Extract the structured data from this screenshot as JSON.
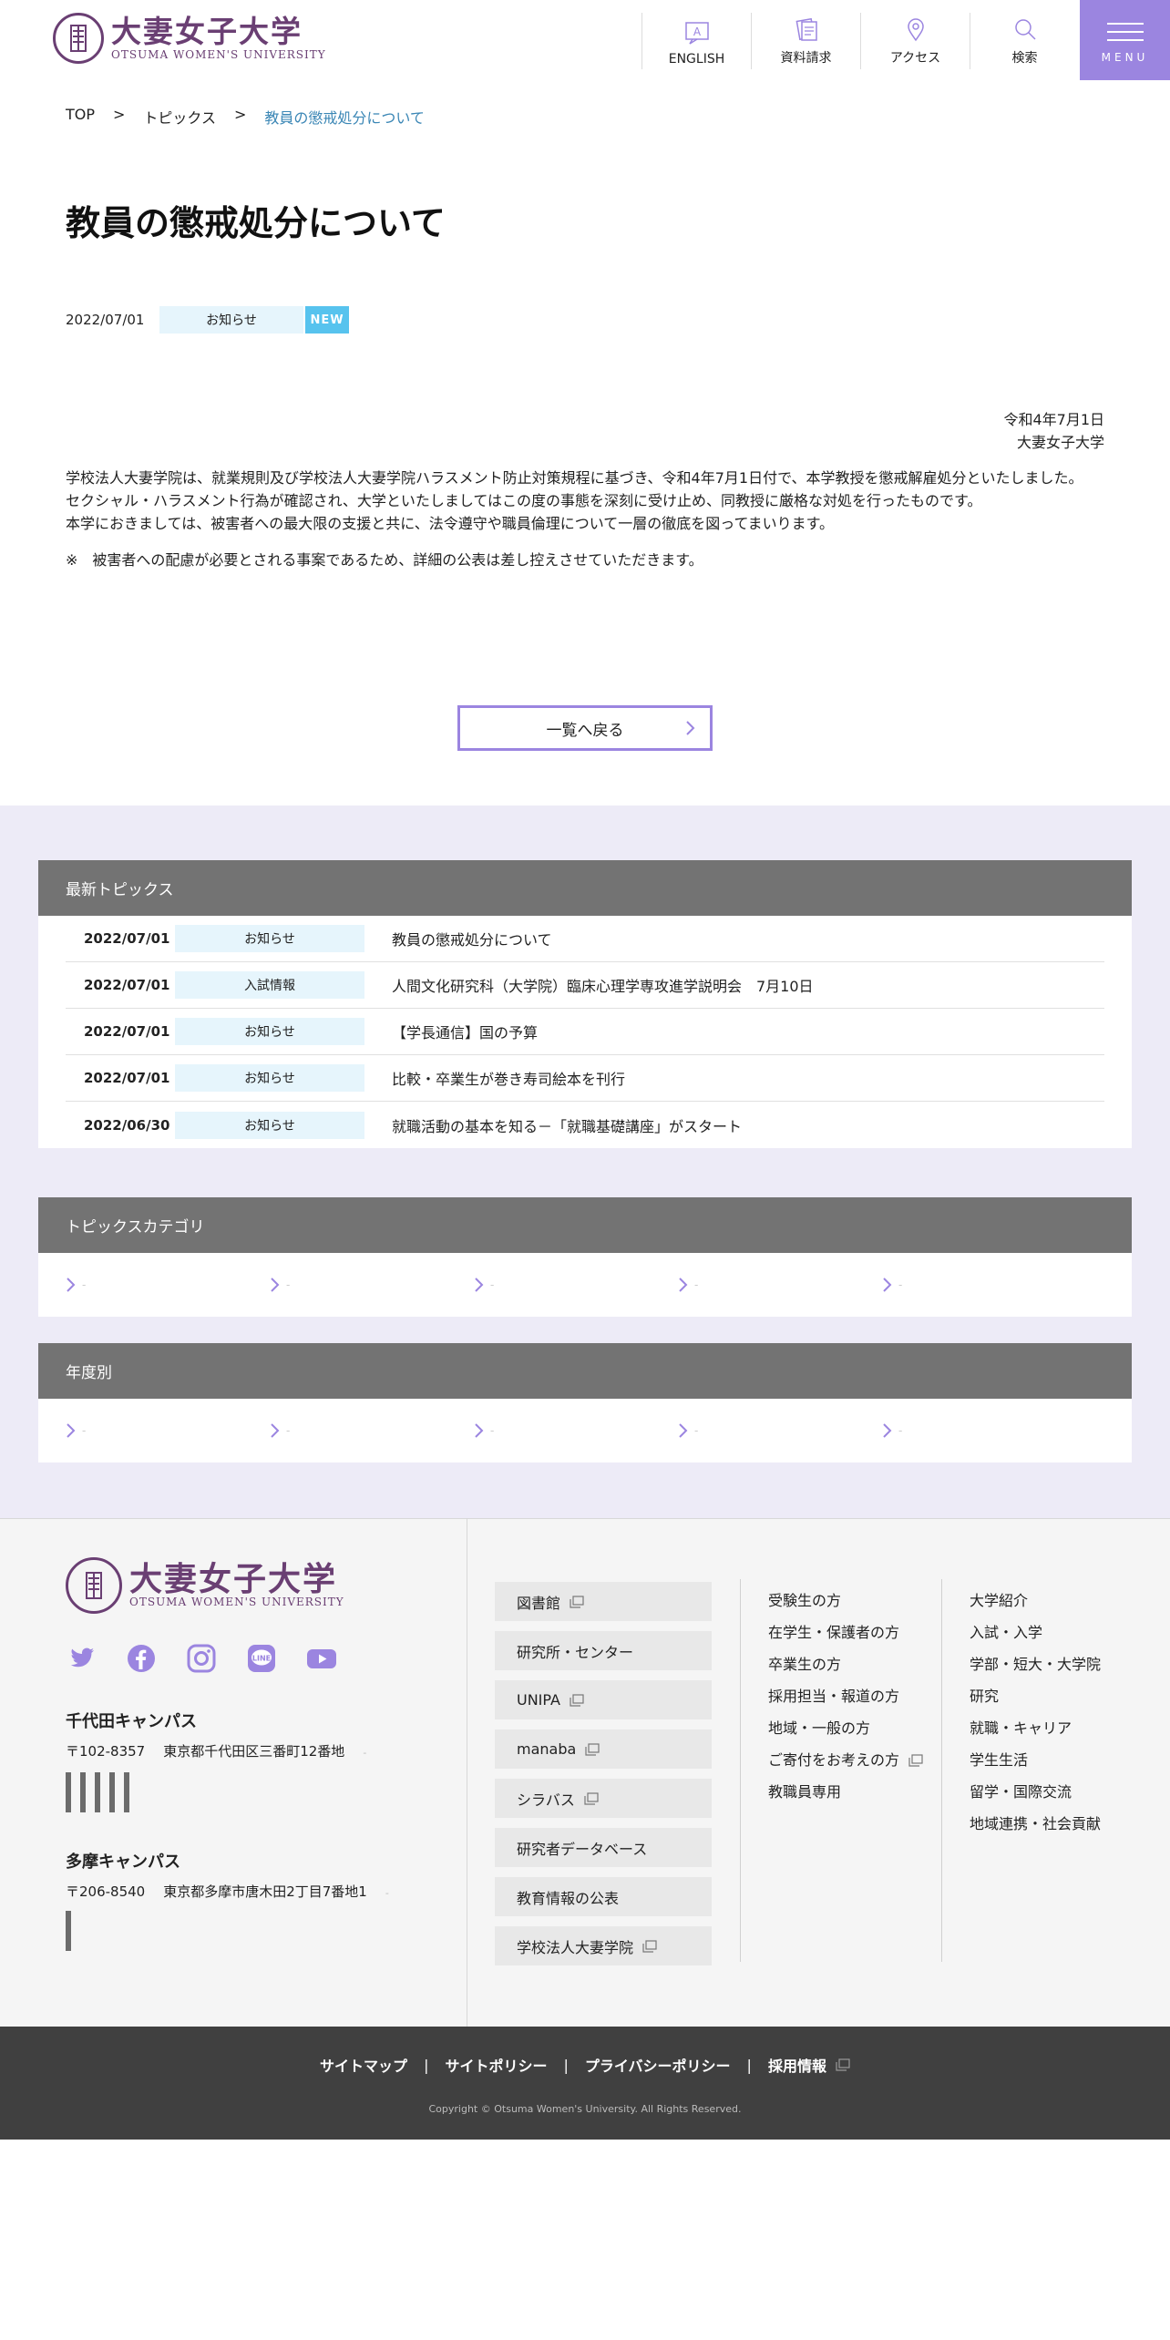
{
  "header": {
    "logo_jp": "大妻女子大学",
    "logo_en": "OTSUMA WOMEN'S UNIVERSITY",
    "nav": [
      {
        "label": "ENGLISH",
        "icon": "english-icon"
      },
      {
        "label": "資料請求",
        "icon": "document-request-icon"
      },
      {
        "label": "アクセス",
        "icon": "map-pin-icon"
      },
      {
        "label": "検索",
        "icon": "search-icon"
      }
    ],
    "menu_label": "MENU"
  },
  "breadcrumb": {
    "items": [
      "TOP",
      "トピックス"
    ],
    "separator": ">",
    "current": "教員の懲戒処分について"
  },
  "article": {
    "title": "教員の懲戒処分について",
    "date": "2022/07/01",
    "category": "お知らせ",
    "new_badge": "NEW",
    "sign_date": "令和4年7月1日",
    "sign_org": "大妻女子大学",
    "paragraphs": [
      "学校法人大妻学院は、就業規則及び学校法人大妻学院ハラスメント防止対策規程に基づき、令和4年7月1日付で、本学教授を懲戒解雇処分といたしました。",
      "セクシャル・ハラスメント行為が確認され、大学といたしましてはこの度の事態を深刻に受け止め、同教授に厳格な対処を行ったものです。",
      "本学におきましては、被害者への最大限の支援と共に、法令遵守や職員倫理について一層の徹底を図ってまいります。"
    ],
    "note": "※　被害者への配慮が必要とされる事案であるため、詳細の公表は差し控えさせていただきます。",
    "back_label": "一覧へ戻る"
  },
  "latest": {
    "heading": "最新トピックス",
    "rows": [
      {
        "date": "2022/07/01",
        "category": "お知らせ",
        "title": "教員の懲戒処分について"
      },
      {
        "date": "2022/07/01",
        "category": "入試情報",
        "title": "人間文化研究科（大学院）臨床心理学専攻進学説明会　7月10日"
      },
      {
        "date": "2022/07/01",
        "category": "お知らせ",
        "title": "【学長通信】国の予算"
      },
      {
        "date": "2022/07/01",
        "category": "お知らせ",
        "title": "比較・卒業生が巻き寿司絵本を刊行"
      },
      {
        "date": "2022/06/30",
        "category": "お知らせ",
        "title": "就職活動の基本を知る－「就職基礎講座」がスタート"
      }
    ]
  },
  "categories": {
    "heading": "トピックスカテゴリ",
    "items": [
      "-",
      "-",
      "-",
      "-",
      "-"
    ]
  },
  "years": {
    "heading": "年度別",
    "items": [
      "-",
      "-",
      "-",
      "-",
      "-"
    ]
  },
  "footer": {
    "logo_jp": "大妻女子大学",
    "logo_en": "OTSUMA WOMEN'S UNIVERSITY",
    "social": [
      "twitter-icon",
      "facebook-icon",
      "instagram-icon",
      "line-icon",
      "youtube-icon"
    ],
    "campus1": {
      "name": "千代田キャンパス",
      "zip": "〒102-8357",
      "address": "東京都千代田区三番町12番地",
      "dash": "-"
    },
    "campus2": {
      "name": "多摩キャンパス",
      "zip": "〒206-8540",
      "address": "東京都多摩市唐木田2丁目7番地1",
      "dash": "-"
    },
    "buttons": [
      {
        "label": "図書館",
        "ext": true
      },
      {
        "label": "研究所・センター",
        "ext": false
      },
      {
        "label": "UNIPA",
        "ext": true
      },
      {
        "label": "manaba",
        "ext": true
      },
      {
        "label": "シラバス",
        "ext": true
      },
      {
        "label": "研究者データベース",
        "ext": false
      },
      {
        "label": "教育情報の公表",
        "ext": false
      },
      {
        "label": "学校法人大妻学院",
        "ext": true
      }
    ],
    "col2": [
      {
        "label": "受験生の方",
        "ext": false
      },
      {
        "label": "在学生・保護者の方",
        "ext": false
      },
      {
        "label": "卒業生の方",
        "ext": false
      },
      {
        "label": "採用担当・報道の方",
        "ext": false
      },
      {
        "label": "地域・一般の方",
        "ext": false
      },
      {
        "label": "ご寄付をお考えの方",
        "ext": true
      },
      {
        "label": "教職員専用",
        "ext": false
      }
    ],
    "col3": [
      "大学紹介",
      "入試・入学",
      "学部・短大・大学院",
      "研究",
      "就職・キャリア",
      "学生生活",
      "留学・国際交流",
      "地域連携・社会貢献"
    ],
    "bottom_links": [
      "サイトマップ",
      "サイトポリシー",
      "プライバシーポリシー",
      "採用情報"
    ],
    "separator": "|",
    "copyright": "Copyright © Otsuma Women's University.  All Rights Reserved."
  },
  "colors": {
    "brand_purple": "#6a3f73",
    "accent_lavender": "#9b85e0",
    "new_badge": "#57c3ee",
    "tag_bg": "#e6f5fc",
    "panel_head": "#737373",
    "footer_bar": "#404040"
  }
}
